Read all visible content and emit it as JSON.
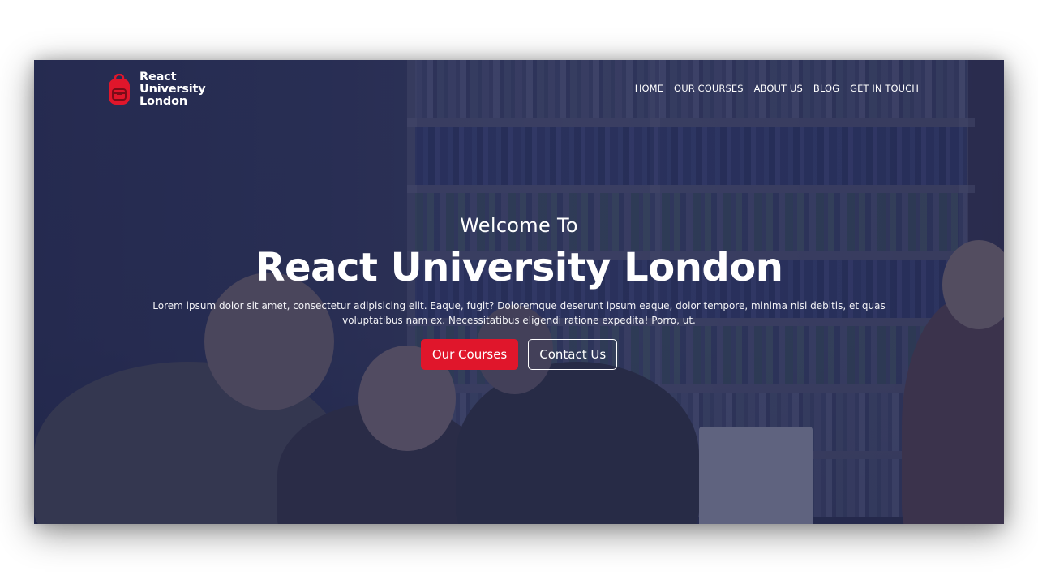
{
  "brand": {
    "name_line1": "React",
    "name_line2": "University",
    "name_line3": "London",
    "icon": "backpack-icon",
    "icon_color": "#e0162b"
  },
  "nav": {
    "items": [
      {
        "label": "HOME"
      },
      {
        "label": "OUR COURSES"
      },
      {
        "label": "ABOUT US"
      },
      {
        "label": "BLOG"
      },
      {
        "label": "GET IN TOUCH"
      }
    ]
  },
  "hero": {
    "welcome": "Welcome To",
    "title": "React University London",
    "description": "Lorem ipsum dolor sit amet, consectetur adipisicing elit. Eaque, fugit? Doloremque deserunt ipsum eaque, dolor tempore, minima nisi debitis, et quas voluptatibus nam ex. Necessitatibus eligendi ratione expedita! Porro, ut.",
    "primary_button": "Our Courses",
    "secondary_button": "Contact Us"
  },
  "colors": {
    "accent": "#e0162b",
    "overlay": "#232852",
    "text": "#ffffff"
  }
}
